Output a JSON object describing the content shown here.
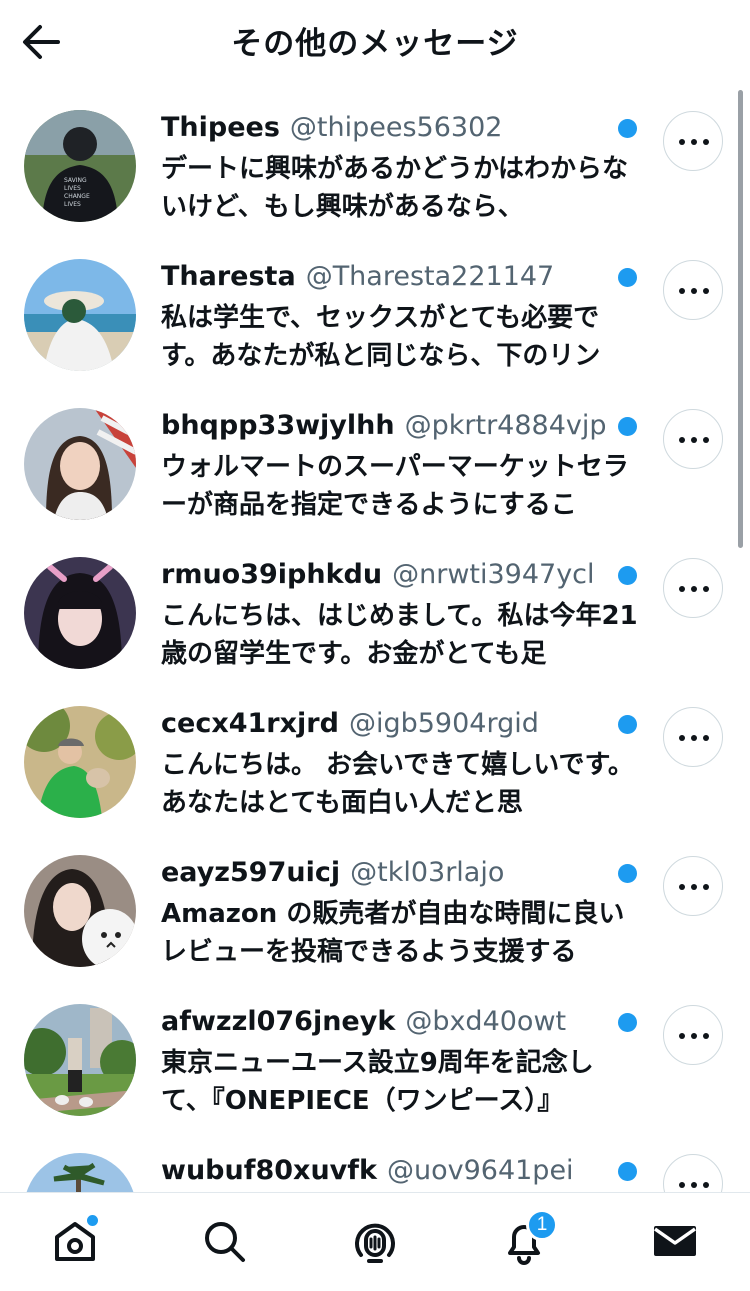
{
  "header": {
    "title": "その他のメッセージ",
    "back_icon": "arrow-left-icon"
  },
  "conversations": [
    {
      "name": "Thipees",
      "handle": "@thipees56302",
      "preview": "デートに興味があるかどうかはわからないけど、もし興味があるなら、",
      "unread": true
    },
    {
      "name": "Tharesta",
      "handle": "@Tharesta221147",
      "preview": "私は学生で、セックスがとても必要です。あなたが私と同じなら、下のリン",
      "unread": true
    },
    {
      "name": "bhqpp33wjylhh",
      "handle": "@pkrtr4884vjp",
      "preview": "ウォルマートのスーパーマーケットセラーが商品を指定できるようにするこ",
      "unread": true
    },
    {
      "name": "rmuo39iphkdu",
      "handle": "@nrwti3947ycl",
      "preview": "こんにちは、はじめまして。私は今年21歳の留学生です。お金がとても足",
      "unread": true
    },
    {
      "name": "cecx41rxjrd",
      "handle": "@igb5904rgid",
      "preview": "こんにちは。 お会いできて嬉しいです。 あなたはとても面白い人だと思",
      "unread": true
    },
    {
      "name": "eayz597uicj",
      "handle": "@tkl03rlajo",
      "preview": "Amazon の販売者が自由な時間に良いレビューを投稿できるよう支援する",
      "unread": true
    },
    {
      "name": "afwzzl076jneyk",
      "handle": "@bxd40owt",
      "preview": "東京ニューユース設立9周年を記念して、『ONEPIECE（ワンピース）』",
      "unread": true
    },
    {
      "name": "wubuf80xuvfk",
      "handle": "@uov9641pei",
      "preview": "",
      "unread": true
    }
  ],
  "more_icon": "more-horizontal-icon",
  "bottom_nav": [
    {
      "icon": "home-icon",
      "has_dot": true
    },
    {
      "icon": "search-icon"
    },
    {
      "icon": "spaces-icon"
    },
    {
      "icon": "notifications-icon",
      "badge": "1"
    },
    {
      "icon": "messages-icon",
      "active": true
    }
  ],
  "colors": {
    "accent": "#1d9bf0",
    "text": "#0f1419",
    "secondary": "#536471",
    "border": "#cfd9de"
  }
}
